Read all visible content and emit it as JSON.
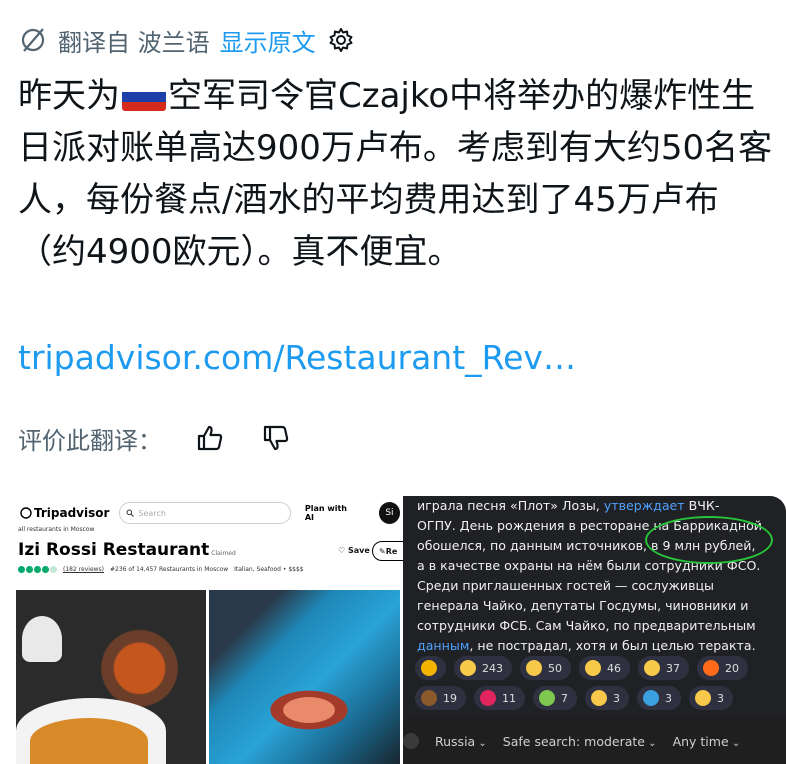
{
  "header": {
    "translated_from": "翻译自 波兰语",
    "show_original": "显示原文"
  },
  "post": {
    "text_before_flag": "昨天为",
    "text_after_flag": "空军司令官Czajko中将举办的爆炸性生日派对账单高达900万卢布。考虑到有大约50名客人，每份餐点/酒水的平均费用达到了45万卢布（约4900欧元）。真不便宜。",
    "flag_colors": [
      "#ffffff",
      "#1c3faa",
      "#d52b1e"
    ]
  },
  "link": {
    "text": "tripadvisor.com/Restaurant_Rev…"
  },
  "rate": {
    "label": "评价此翻译：",
    "thumbs_up": "thumbs-up-icon",
    "thumbs_down": "thumbs-down-icon"
  },
  "left_screenshot": {
    "logo": "Tripadvisor",
    "search_placeholder": "Search",
    "plan": "Plan with AI",
    "avatar": "Si",
    "breadcrumb": "all restaurants in Moscow",
    "title": "Izi Rossi Restaurant",
    "claimed": "Claimed",
    "save": "Save",
    "review": "Re",
    "reviews": "(182 reviews)",
    "rank": "#236 of 14,457 Restaurants in Moscow",
    "cuisine": "Italian, Seafood • $$$$"
  },
  "right_screenshot": {
    "line1": "играла песня «Плот» Лозы, ",
    "line1_link": "утверждает",
    "line1_rest": " ВЧК-",
    "line2": "ОГПУ. День рождения в ресторане на Баррикадной",
    "line3": "обошелся, по данным источников, в 9 млн рублей,",
    "line4": "а в качестве охраны на нём были сотрудники ФСО.",
    "line5": "Среди приглашенных гостей — сослуживцы",
    "line6": "генерала Чайко, депутаты Госдумы, чиновники и",
    "line7": "сотрудники ФСБ. Сам Чайко, по предварительным",
    "line8_link": "данным",
    "line8_rest": ", не пострадал, хотя и был целью теракта.",
    "reactions": [
      {
        "icon": "star-icon",
        "count": "",
        "color": "#f5b400"
      },
      {
        "icon": "grin-icon",
        "count": "243",
        "color": "#f7c84a"
      },
      {
        "icon": "surprise-icon",
        "count": "50",
        "color": "#f7c84a"
      },
      {
        "icon": "thumbs-up-icon",
        "count": "46",
        "color": "#f7c84a"
      },
      {
        "icon": "rofl-icon",
        "count": "37",
        "color": "#f7c84a"
      },
      {
        "icon": "fire-icon",
        "count": "20",
        "color": "#ff6a1a"
      },
      {
        "icon": "poop-icon",
        "count": "19",
        "color": "#8b5a2b"
      },
      {
        "icon": "heart-icon",
        "count": "11",
        "color": "#e0245e"
      },
      {
        "icon": "nauseated-icon",
        "count": "7",
        "color": "#7ec850"
      },
      {
        "icon": "handshake-icon",
        "count": "3",
        "color": "#f7c84a"
      },
      {
        "icon": "whale-icon",
        "count": "3",
        "color": "#3aa0e0"
      },
      {
        "icon": "woozy-icon",
        "count": "3",
        "color": "#f7c84a"
      }
    ],
    "filters": {
      "region": "Russia",
      "safe": "Safe search: moderate",
      "time": "Any time"
    }
  }
}
